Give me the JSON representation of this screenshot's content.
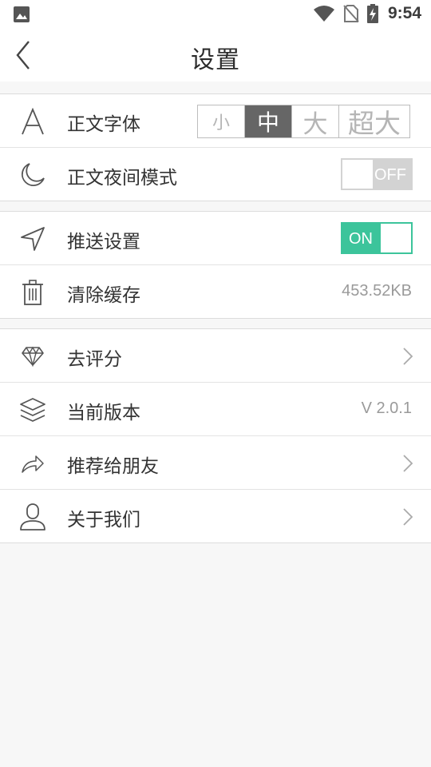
{
  "status_bar": {
    "time": "9:54",
    "icons": [
      "image-icon",
      "wifi-icon",
      "no-sim-icon",
      "battery-charging-icon"
    ]
  },
  "header": {
    "title": "设置",
    "back_icon": "chevron-left-icon"
  },
  "settings": {
    "font": {
      "label": "正文字体",
      "icon": "font-a-icon",
      "options": [
        "小",
        "中",
        "大",
        "超大"
      ],
      "selected": "中"
    },
    "night_mode": {
      "label": "正文夜间模式",
      "icon": "moon-icon",
      "toggle_text": "OFF",
      "enabled": false
    },
    "push": {
      "label": "推送设置",
      "icon": "navigation-arrow-icon",
      "toggle_text": "ON",
      "enabled": true
    },
    "cache": {
      "label": "清除缓存",
      "icon": "trash-icon",
      "value": "453.52KB"
    },
    "rate": {
      "label": "去评分",
      "icon": "diamond-icon"
    },
    "version": {
      "label": "当前版本",
      "icon": "layers-icon",
      "value": "V 2.0.1"
    },
    "share": {
      "label": "推荐给朋友",
      "icon": "share-arrow-icon"
    },
    "about": {
      "label": "关于我们",
      "icon": "user-icon"
    }
  },
  "colors": {
    "accent_on": "#3cc49b",
    "selected_segment": "#666666",
    "background": "#f7f7f7"
  }
}
